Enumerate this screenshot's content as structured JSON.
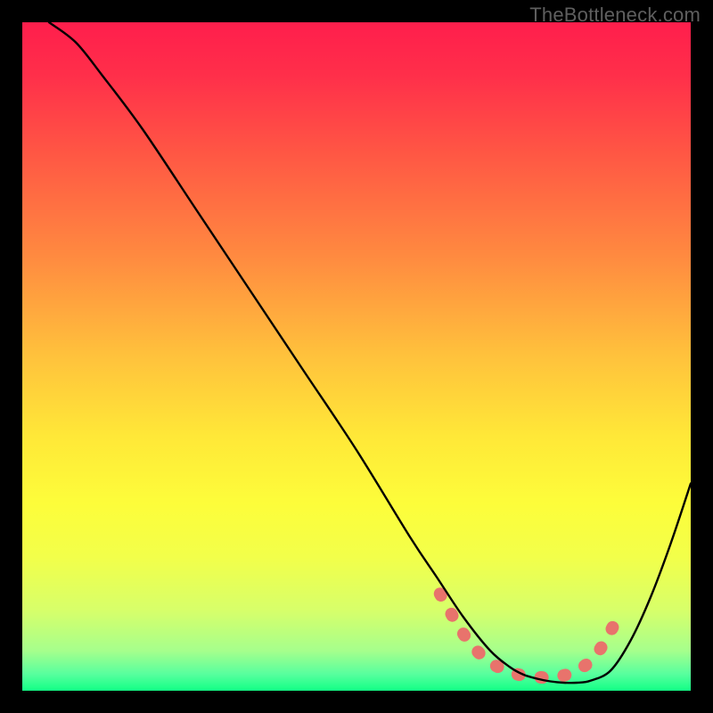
{
  "watermark": "TheBottleneck.com",
  "plot": {
    "inner_width": 750,
    "inner_height": 750,
    "inner_left": 25,
    "inner_top": 25,
    "gradient_stops": [
      {
        "offset": 0.0,
        "color": "#ff1e4c"
      },
      {
        "offset": 0.08,
        "color": "#ff2f4a"
      },
      {
        "offset": 0.2,
        "color": "#ff5844"
      },
      {
        "offset": 0.35,
        "color": "#ff8a40"
      },
      {
        "offset": 0.5,
        "color": "#ffc23c"
      },
      {
        "offset": 0.62,
        "color": "#ffe838"
      },
      {
        "offset": 0.72,
        "color": "#fdfd3a"
      },
      {
        "offset": 0.8,
        "color": "#f2ff4a"
      },
      {
        "offset": 0.88,
        "color": "#d7ff6a"
      },
      {
        "offset": 0.94,
        "color": "#a6ff8c"
      },
      {
        "offset": 0.975,
        "color": "#58ff9e"
      },
      {
        "offset": 1.0,
        "color": "#12ff86"
      }
    ]
  },
  "chart_data": {
    "type": "line",
    "title": "",
    "xlabel": "",
    "ylabel": "",
    "xlim": [
      0,
      100
    ],
    "ylim": [
      0,
      100
    ],
    "series": [
      {
        "name": "curve",
        "x": [
          4,
          8,
          12,
          18,
          26,
          34,
          42,
          50,
          58,
          62,
          66,
          70,
          73,
          75,
          77,
          79,
          81,
          83,
          85,
          88,
          91,
          94,
          97,
          100
        ],
        "y": [
          100,
          97,
          92,
          84,
          72,
          60,
          48,
          36,
          23,
          17,
          11,
          6,
          3.5,
          2.4,
          1.8,
          1.4,
          1.2,
          1.2,
          1.5,
          3,
          7.5,
          14,
          22,
          31
        ]
      }
    ],
    "highlight_band": {
      "name": "bottleneck-band",
      "color": "#e8736c",
      "x": [
        62.5,
        66,
        69,
        71.5,
        73.5,
        75.5,
        77.5,
        79.5,
        82,
        84.5,
        86.5,
        88.5
      ],
      "y": [
        14.5,
        8.5,
        5.0,
        3.4,
        2.6,
        2.2,
        2.0,
        2.0,
        2.6,
        4.0,
        6.3,
        9.8
      ]
    }
  }
}
